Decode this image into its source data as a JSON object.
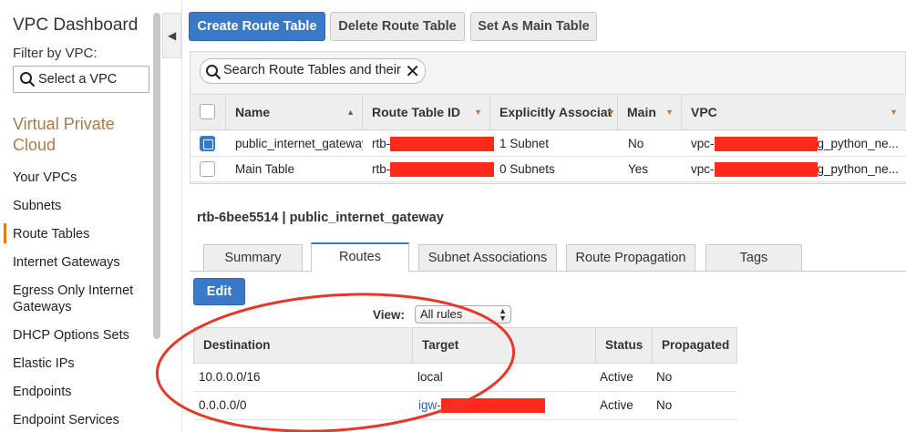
{
  "sidebar": {
    "title": "VPC Dashboard",
    "filter_label": "Filter by VPC:",
    "vpc_select_placeholder": "Select a VPC",
    "section": "Virtual Private Cloud",
    "items": [
      {
        "label": "Your VPCs",
        "active": false
      },
      {
        "label": "Subnets",
        "active": false
      },
      {
        "label": "Route Tables",
        "active": true
      },
      {
        "label": "Internet Gateways",
        "active": false
      },
      {
        "label": "Egress Only Internet Gateways",
        "active": false
      },
      {
        "label": "DHCP Options Sets",
        "active": false
      },
      {
        "label": "Elastic IPs",
        "active": false
      },
      {
        "label": "Endpoints",
        "active": false
      },
      {
        "label": "Endpoint Services",
        "active": false
      }
    ]
  },
  "toolbar": {
    "create_label": "Create Route Table",
    "delete_label": "Delete Route Table",
    "set_main_label": "Set As Main Table"
  },
  "search": {
    "placeholder": "Search Route Tables and their"
  },
  "table": {
    "columns": [
      "Name",
      "Route Table ID",
      "Explicitly Associat",
      "Main",
      "VPC"
    ],
    "rows": [
      {
        "selected": true,
        "name": "public_internet_gateway",
        "id_prefix": "rtb-",
        "assoc": "1 Subnet",
        "main": "No",
        "vpc_prefix": "vpc-",
        "vpc_suffix": "g_python_ne..."
      },
      {
        "selected": false,
        "name": "Main Table",
        "id_prefix": "rtb-",
        "assoc": "0 Subnets",
        "main": "Yes",
        "vpc_prefix": "vpc-",
        "vpc_suffix": "g_python_ne..."
      }
    ]
  },
  "detail": {
    "title": "rtb-6bee5514 | public_internet_gateway",
    "tabs": [
      {
        "label": "Summary",
        "active": false
      },
      {
        "label": "Routes",
        "active": true
      },
      {
        "label": "Subnet Associations",
        "active": false
      },
      {
        "label": "Route Propagation",
        "active": false
      },
      {
        "label": "Tags",
        "active": false
      }
    ],
    "edit_label": "Edit",
    "view_label": "View:",
    "view_value": "All rules",
    "routes": {
      "columns": [
        "Destination",
        "Target",
        "Status",
        "Propagated"
      ],
      "rows": [
        {
          "destination": "10.0.0.0/16",
          "target": "local",
          "status": "Active",
          "propagated": "No"
        },
        {
          "destination": "0.0.0.0/0",
          "target": "igw-",
          "status": "Active",
          "propagated": "No"
        }
      ]
    }
  },
  "colors": {
    "primary": "#3a79c5",
    "section": "#a87b4f",
    "active_nav": "#e47911",
    "redaction": "#ff2a1a",
    "annotation": "#e8362a"
  }
}
